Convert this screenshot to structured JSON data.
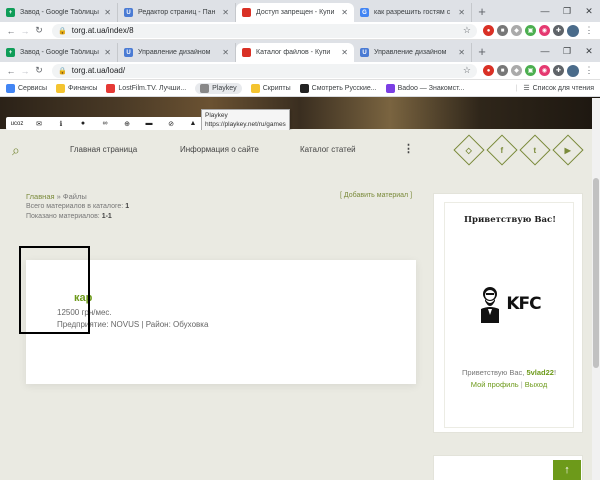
{
  "window1": {
    "tabs": [
      {
        "label": "Завод - Google Таблицы",
        "icon": "sheets-icon",
        "color": "#0f9d58",
        "glyph": "+"
      },
      {
        "label": "Редактор страниц - Пан",
        "icon": "ucoz-icon",
        "color": "#4a7bd4",
        "glyph": "U"
      },
      {
        "label": "Доступ запрещен - Купи",
        "icon": "book-icon",
        "color": "#d93025",
        "glyph": ""
      },
      {
        "label": "как разрешить гостям с",
        "icon": "google-icon",
        "color": "#4285f4",
        "glyph": "G"
      }
    ],
    "url": "torg.at.ua/index/8"
  },
  "window2": {
    "tabs": [
      {
        "label": "Завод - Google Таблицы",
        "icon": "sheets-icon",
        "color": "#0f9d58",
        "glyph": "+"
      },
      {
        "label": "Управление дизайном",
        "icon": "ucoz-icon",
        "color": "#4a7bd4",
        "glyph": "U"
      },
      {
        "label": "Каталог файлов - Купи",
        "icon": "book-icon",
        "color": "#d93025",
        "glyph": ""
      },
      {
        "label": "Управление дизайном",
        "icon": "ucoz-icon",
        "color": "#4a7bd4",
        "glyph": "U"
      }
    ],
    "url": "torg.at.ua/load/"
  },
  "bookmarks": {
    "items": [
      {
        "label": "Сервисы",
        "icon": "apps-icon",
        "color": "#4285f4"
      },
      {
        "label": "Финансы",
        "icon": "folder-icon",
        "color": "#f4c430"
      },
      {
        "label": "LostFilm.TV. Лучши...",
        "icon": "lostfilm-icon",
        "color": "#e53935"
      },
      {
        "label": "Playkey",
        "icon": "playkey-icon",
        "color": "#888888"
      },
      {
        "label": "Скрипты",
        "icon": "folder-icon",
        "color": "#f4c430"
      },
      {
        "label": "Смотреть Русские...",
        "icon": "mask-icon",
        "color": "#222222"
      },
      {
        "label": "Badoo — Знакомст...",
        "icon": "badoo-icon",
        "color": "#7b3fe4"
      }
    ],
    "reading_list": "Список для чтения"
  },
  "tooltip": {
    "title": "Playkey",
    "url": "https://playkey.net/ru/games"
  },
  "site": {
    "nav": [
      "Главная страница",
      "Информация о сайте",
      "Каталог статей"
    ],
    "social": [
      "◇",
      "f",
      "t",
      "▶"
    ],
    "breadcrumb": {
      "home": "Главная",
      "sep": "»",
      "current": "Файлы"
    },
    "stats": {
      "total_label": "Всего материалов в каталоге:",
      "total": "1",
      "shown_label": "Показано материалов:",
      "shown": "1-1"
    },
    "add_material": "[ Добавить материал ]",
    "card": {
      "title": "кар",
      "price": "12500 грн/мес.",
      "meta": "Предприятие: NOVUS | Район: Обуховка"
    },
    "sidebar": {
      "heading": "Приветствую Вас!",
      "logo_text": "KFC",
      "greeting": "Приветствую Вас,",
      "username": "5vlad22",
      "profile_link": "Мой профиль",
      "logout_link": "Выход"
    }
  },
  "colors": {
    "accent": "#6d9a1a",
    "olive": "#7a8a3a",
    "bg": "#eaeae2"
  }
}
